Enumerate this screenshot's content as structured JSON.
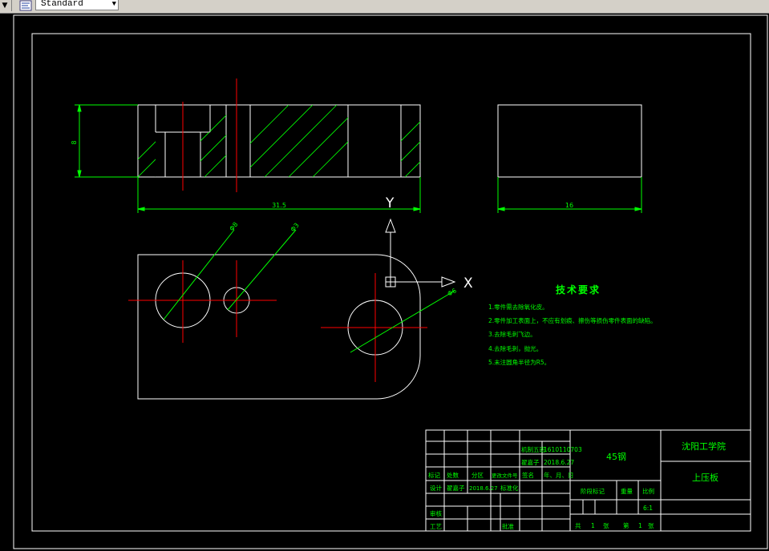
{
  "toolbar": {
    "style_combo_value": "Standard",
    "colors": {
      "face": "#d4d0c8"
    }
  },
  "drawing": {
    "colors": {
      "background": "#000000",
      "outline": "#ffffff",
      "dimension": "#00ff00",
      "centerline": "#ff0000",
      "text": "#00ff00",
      "hatch": "#00ff00"
    },
    "dimensions": {
      "height": "8",
      "length": "31.5",
      "width": "16",
      "dia1": "Φ8",
      "dia2": "Φ3",
      "dia3": "Φ6"
    },
    "ucs": {
      "x": "X",
      "y": "Y"
    }
  },
  "tech_req": {
    "title": "技术要求",
    "items": [
      "1.零件需去除氧化皮。",
      "2.零件加工表面上，不应有划痕、擦伤等损伤零件表面的缺陷。",
      "3.去除毛刺飞边。",
      "4.去除毛刺，抛光。",
      "5.未注圆角半径为R5。"
    ]
  },
  "title_block": {
    "drawn_label": "机制五班",
    "student_id": "1610110703",
    "name": "翟嘉子",
    "date_short": "2018.6.27",
    "mark": "标记",
    "count": "处数",
    "zone": "分区",
    "doc_no": "更改文件号",
    "sign": "签名",
    "ymd": "年、月、日",
    "design": "设计",
    "design_name": "翟嘉子",
    "design_date": "2018.6.27",
    "standardize": "标准化",
    "review": "审核",
    "process": "工艺",
    "approve": "批准",
    "material": "45钢",
    "stage_mark": "阶段标记",
    "weight": "重量",
    "scale_label": "比例",
    "scale": "6:1",
    "sheets_total_label": "共",
    "sheets_total": "1",
    "sheet_word": "张",
    "sheet_no_label": "第",
    "sheet_no": "1",
    "school": "沈阳工学院",
    "part_name": "上压板"
  }
}
